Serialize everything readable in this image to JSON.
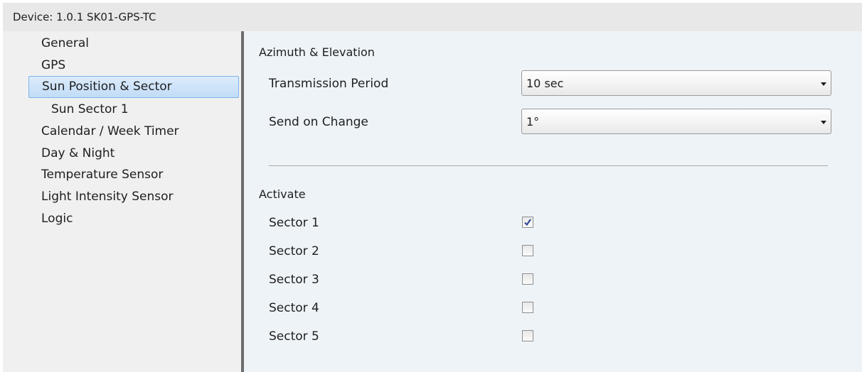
{
  "window": {
    "title": "Device: 1.0.1  SK01-GPS-TC"
  },
  "sidebar": {
    "items": [
      {
        "label": "General"
      },
      {
        "label": "GPS"
      },
      {
        "label": "Sun Position & Sector",
        "selected": true
      },
      {
        "label": "Sun Sector 1",
        "indent": 1
      },
      {
        "label": "Calendar / Week Timer"
      },
      {
        "label": "Day & Night"
      },
      {
        "label": "Temperature Sensor"
      },
      {
        "label": "Light Intensity Sensor"
      },
      {
        "label": "Logic"
      }
    ]
  },
  "main": {
    "azimuth_section": {
      "heading": "Azimuth & Elevation",
      "transmission_period": {
        "label": "Transmission Period",
        "value": "10 sec"
      },
      "send_on_change": {
        "label": "Send on Change",
        "value": "1°"
      }
    },
    "activate_section": {
      "heading": "Activate",
      "sectors": [
        {
          "label": "Sector 1",
          "checked": true
        },
        {
          "label": "Sector 2",
          "checked": false
        },
        {
          "label": "Sector 3",
          "checked": false
        },
        {
          "label": "Sector 4",
          "checked": false
        },
        {
          "label": "Sector 5",
          "checked": false
        }
      ]
    }
  },
  "colors": {
    "selection_border": "#7eb4ea",
    "selection_fill": "#c1dcf7",
    "checkmark": "#2a3f8f",
    "splitter": "#6c6c6c",
    "content_bg": "#eef3f8"
  }
}
